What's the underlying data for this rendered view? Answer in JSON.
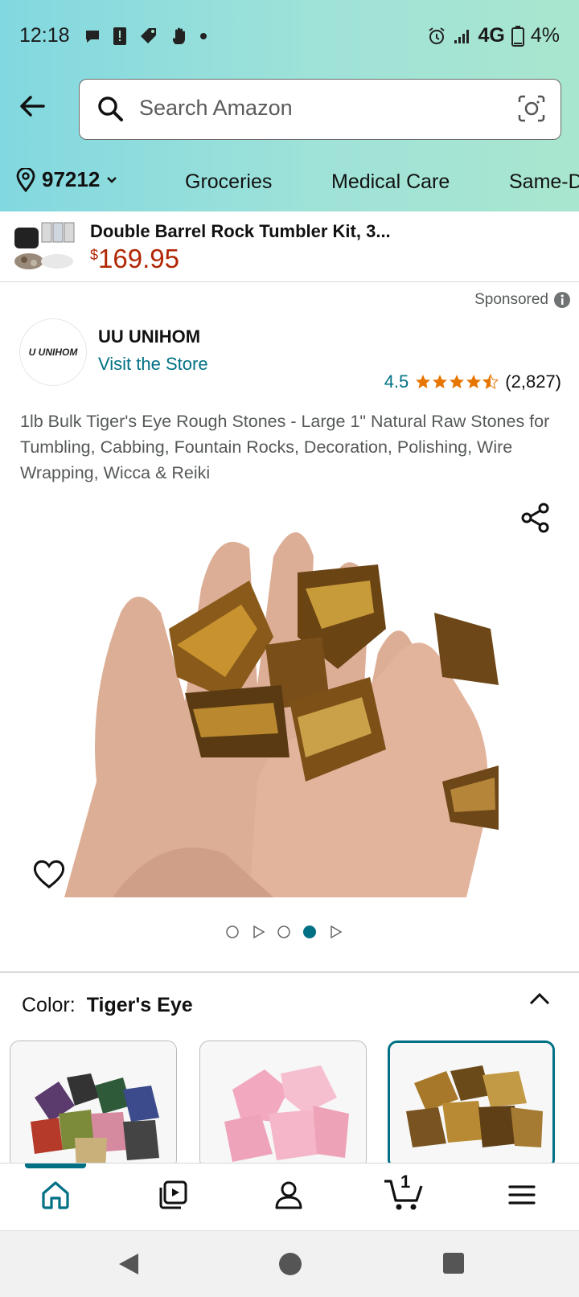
{
  "status_bar": {
    "time": "12:18",
    "network": "4G",
    "battery": "4%"
  },
  "search": {
    "placeholder": "Search Amazon"
  },
  "location": {
    "zip": "97212"
  },
  "nav_links": [
    "Groceries",
    "Medical Care",
    "Same-D"
  ],
  "sponsored_banner": {
    "title": "Double Barrel Rock Tumbler Kit, 3...",
    "currency": "$",
    "price": "169.95"
  },
  "sponsored_label": "Sponsored",
  "store": {
    "logo_text": "U UNIHOM",
    "brand": "UU UNIHOM",
    "visit": "Visit the Store"
  },
  "rating": {
    "value": "4.5",
    "count": "(2,827)",
    "stars": 4.5
  },
  "product": {
    "title": "1lb Bulk Tiger's Eye Rough Stones - Large 1\" Natural Raw Stones for Tumbling, Cabbing, Fountain Rocks, Decoration, Polishing, Wire Wrapping, Wicca & Reiki"
  },
  "carousel": {
    "active_index": 2
  },
  "color": {
    "label": "Color:",
    "selected": "Tiger's Eye"
  },
  "bottom_nav": [
    "home-icon",
    "video-icon",
    "account-icon",
    "cart-icon",
    "menu-icon"
  ],
  "cart_count": "1",
  "colors": {
    "accent": "#007185",
    "price": "#b12704",
    "star": "#e77600"
  }
}
